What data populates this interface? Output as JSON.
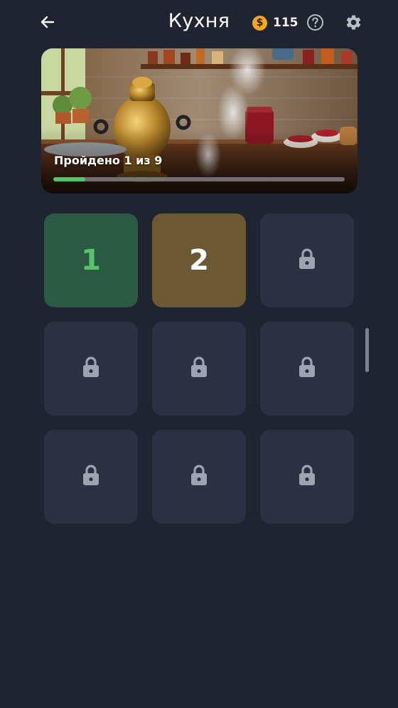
{
  "header": {
    "title": "Кухня",
    "coins": "115",
    "coin_symbol": "$"
  },
  "banner": {
    "progress_label": "Пройдено 1 из 9",
    "progress_fraction": 0.11
  },
  "levels": [
    {
      "label": "1",
      "state": "completed"
    },
    {
      "label": "2",
      "state": "current"
    },
    {
      "label": "",
      "state": "locked"
    },
    {
      "label": "",
      "state": "locked"
    },
    {
      "label": "",
      "state": "locked"
    },
    {
      "label": "",
      "state": "locked"
    },
    {
      "label": "",
      "state": "locked"
    },
    {
      "label": "",
      "state": "locked"
    },
    {
      "label": "",
      "state": "locked"
    }
  ],
  "colors": {
    "background": "#1f2431",
    "tile_locked": "#2b3142",
    "tile_completed": "#2c5943",
    "tile_current": "#6d5834",
    "accent_green": "#54c46a",
    "coin": "#f2a623"
  },
  "icons": {
    "back": "arrow-left-icon",
    "coin": "dollar-coin-icon",
    "help": "question-circle-icon",
    "settings": "gear-icon",
    "locked": "lock-icon"
  }
}
